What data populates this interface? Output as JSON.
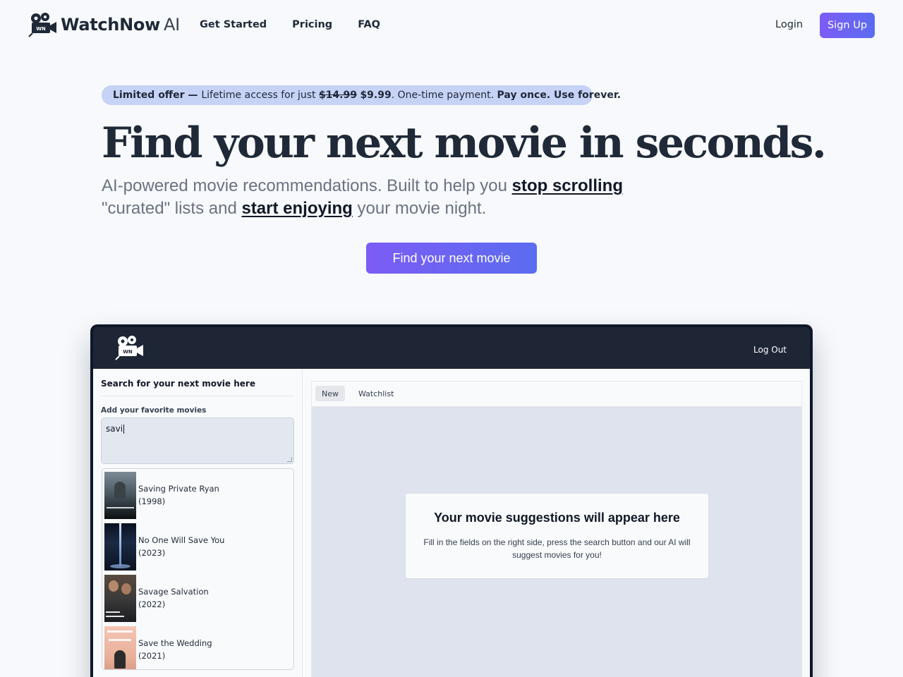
{
  "brand": {
    "name": "WatchNow",
    "suffix": "AI",
    "icon_badge": "WN"
  },
  "nav": {
    "links": [
      "Get Started",
      "Pricing",
      "FAQ"
    ],
    "login_label": "Login",
    "signup_label": "Sign Up"
  },
  "offer": {
    "lead": "Limited offer",
    "dash": " — ",
    "text": "Lifetime access for just ",
    "old_price": "$14.99",
    "new_price": "$9.99",
    "after": ". One-time payment. ",
    "tagline": "Pay once. Use forever."
  },
  "hero": {
    "title": "Find your next movie in seconds.",
    "sub_part1": "AI-powered movie recommendations. Built to help you ",
    "sub_em1": "stop scrolling",
    "sub_part2": "\"curated\" lists and ",
    "sub_em2": "start enjoying",
    "sub_part3": " your movie night.",
    "cta_label": "Find your next movie"
  },
  "app": {
    "logout_label": "Log Out",
    "search_title": "Search for your next movie here",
    "favorites_label": "Add your favorite movies",
    "favorites_value": "savi",
    "suggestions": [
      {
        "title": "Saving Private Ryan",
        "year": "(1998)"
      },
      {
        "title": "No One Will Save You",
        "year": "(2023)"
      },
      {
        "title": "Savage Salvation",
        "year": "(2022)"
      },
      {
        "title": "Save the Wedding",
        "year": "(2021)"
      }
    ],
    "tabs": [
      "New",
      "Watchlist"
    ],
    "empty_title": "Your movie suggestions will appear here",
    "empty_desc": "Fill in the fields on the right side, press the search button and our AI will suggest movies for you!"
  },
  "colors": {
    "accent_start": "#7c5cf5",
    "accent_end": "#5b6cf0",
    "offer_bg": "#c7d2f7",
    "app_bar": "#1e2636"
  }
}
